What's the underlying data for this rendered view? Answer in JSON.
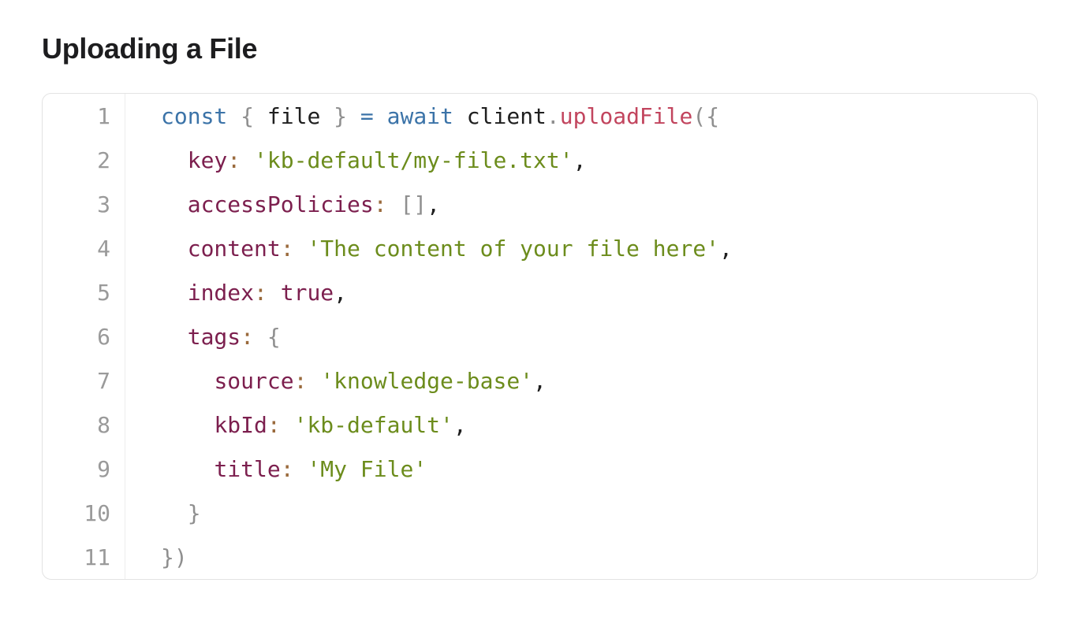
{
  "page": {
    "title": "Uploading a File"
  },
  "code": {
    "lines": [
      {
        "number": "1",
        "tokens": [
          {
            "text": "const",
            "type": "keyword"
          },
          {
            "text": " ",
            "type": "plain"
          },
          {
            "text": "{",
            "type": "punct"
          },
          {
            "text": " file ",
            "type": "plain"
          },
          {
            "text": "}",
            "type": "punct"
          },
          {
            "text": " ",
            "type": "plain"
          },
          {
            "text": "=",
            "type": "keyword"
          },
          {
            "text": " ",
            "type": "plain"
          },
          {
            "text": "await",
            "type": "keyword"
          },
          {
            "text": " client",
            "type": "plain"
          },
          {
            "text": ".",
            "type": "punct"
          },
          {
            "text": "uploadFile",
            "type": "method"
          },
          {
            "text": "({",
            "type": "punct"
          }
        ]
      },
      {
        "number": "2",
        "tokens": [
          {
            "text": "  ",
            "type": "plain"
          },
          {
            "text": "key",
            "type": "prop"
          },
          {
            "text": ":",
            "type": "colon"
          },
          {
            "text": " ",
            "type": "plain"
          },
          {
            "text": "'kb-default/my-file.txt'",
            "type": "string"
          },
          {
            "text": ",",
            "type": "plain"
          }
        ]
      },
      {
        "number": "3",
        "tokens": [
          {
            "text": "  ",
            "type": "plain"
          },
          {
            "text": "accessPolicies",
            "type": "prop"
          },
          {
            "text": ":",
            "type": "colon"
          },
          {
            "text": " ",
            "type": "plain"
          },
          {
            "text": "[]",
            "type": "punct"
          },
          {
            "text": ",",
            "type": "plain"
          }
        ]
      },
      {
        "number": "4",
        "tokens": [
          {
            "text": "  ",
            "type": "plain"
          },
          {
            "text": "content",
            "type": "prop"
          },
          {
            "text": ":",
            "type": "colon"
          },
          {
            "text": " ",
            "type": "plain"
          },
          {
            "text": "'The content of your file here'",
            "type": "string"
          },
          {
            "text": ",",
            "type": "plain"
          }
        ]
      },
      {
        "number": "5",
        "tokens": [
          {
            "text": "  ",
            "type": "plain"
          },
          {
            "text": "index",
            "type": "prop"
          },
          {
            "text": ":",
            "type": "colon"
          },
          {
            "text": " ",
            "type": "plain"
          },
          {
            "text": "true",
            "type": "bool"
          },
          {
            "text": ",",
            "type": "plain"
          }
        ]
      },
      {
        "number": "6",
        "tokens": [
          {
            "text": "  ",
            "type": "plain"
          },
          {
            "text": "tags",
            "type": "prop"
          },
          {
            "text": ":",
            "type": "colon"
          },
          {
            "text": " ",
            "type": "plain"
          },
          {
            "text": "{",
            "type": "punct"
          }
        ]
      },
      {
        "number": "7",
        "tokens": [
          {
            "text": "    ",
            "type": "plain"
          },
          {
            "text": "source",
            "type": "prop"
          },
          {
            "text": ":",
            "type": "colon"
          },
          {
            "text": " ",
            "type": "plain"
          },
          {
            "text": "'knowledge-base'",
            "type": "string"
          },
          {
            "text": ",",
            "type": "plain"
          }
        ]
      },
      {
        "number": "8",
        "tokens": [
          {
            "text": "    ",
            "type": "plain"
          },
          {
            "text": "kbId",
            "type": "prop"
          },
          {
            "text": ":",
            "type": "colon"
          },
          {
            "text": " ",
            "type": "plain"
          },
          {
            "text": "'kb-default'",
            "type": "string"
          },
          {
            "text": ",",
            "type": "plain"
          }
        ]
      },
      {
        "number": "9",
        "tokens": [
          {
            "text": "    ",
            "type": "plain"
          },
          {
            "text": "title",
            "type": "prop"
          },
          {
            "text": ":",
            "type": "colon"
          },
          {
            "text": " ",
            "type": "plain"
          },
          {
            "text": "'My File'",
            "type": "string"
          }
        ]
      },
      {
        "number": "10",
        "tokens": [
          {
            "text": "  ",
            "type": "plain"
          },
          {
            "text": "}",
            "type": "punct"
          }
        ]
      },
      {
        "number": "11",
        "tokens": [
          {
            "text": "})",
            "type": "punct"
          }
        ]
      }
    ]
  }
}
